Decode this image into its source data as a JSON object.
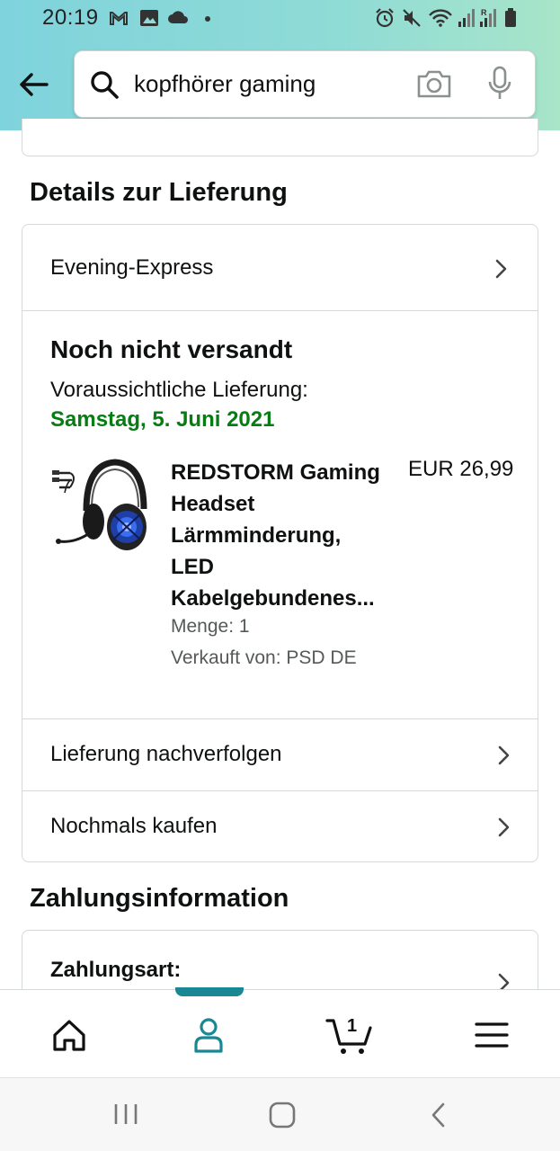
{
  "status_bar": {
    "time": "20:19",
    "left_icons": [
      "gmail-icon",
      "image-icon",
      "cloud-icon",
      "dot-icon"
    ],
    "right_icons": [
      "alarm-icon",
      "mute-icon",
      "wifi-icon",
      "signal-icon",
      "signal-roaming-icon",
      "battery-icon"
    ],
    "roaming_indicator": "R"
  },
  "header": {
    "search_query": "kopfhörer gaming",
    "accent_color": "#7fd3dc"
  },
  "delivery": {
    "section_title": "Details zur Lieferung",
    "shipping_method": "Evening-Express",
    "status": "Noch nicht versandt",
    "eta_label": "Voraussichtliche Lieferung:",
    "eta_date": "Samstag, 5. Juni 2021",
    "eta_color": "#067d12",
    "product": {
      "title_lines": [
        "REDSTORM Gaming",
        "Headset",
        "Lärmminderung,",
        "LED",
        "Kabelgebundenes..."
      ],
      "price": "EUR 26,99",
      "quantity": "Menge: 1",
      "seller": "Verkauft von: PSD DE"
    },
    "track_label": "Lieferung nachverfolgen",
    "rebuy_label": "Nochmals kaufen"
  },
  "payment": {
    "section_title": "Zahlungsinformation",
    "method_label": "Zahlungsart:"
  },
  "bottom_nav": {
    "items": [
      "home-icon",
      "account-icon",
      "cart-icon",
      "menu-icon"
    ],
    "cart_count": "1",
    "active_color": "#1a8894"
  },
  "system_nav": [
    "recents-icon",
    "home-button-icon",
    "back-button-icon"
  ]
}
